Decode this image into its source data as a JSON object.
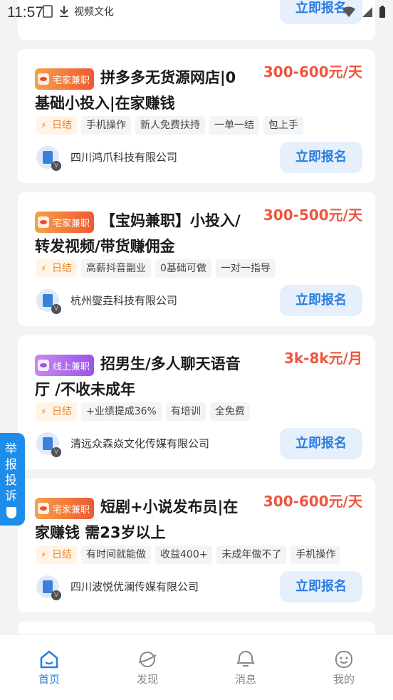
{
  "status_bar": {
    "time": "11:57",
    "notification_text": "视频文化"
  },
  "top_card": {
    "apply_label": "立即报名"
  },
  "jobs": [
    {
      "category": "宅家兼职",
      "title": "拼多多无货源网店|0基础小投入|在家赚钱",
      "salary": "300-600元/天",
      "tags": [
        "日结",
        "手机操作",
        "新人免费扶持",
        "一单一结",
        "包上手"
      ],
      "company": "四川鸿爪科技有限公司",
      "apply_label": "立即报名"
    },
    {
      "category": "宅家兼职",
      "title": "【宝妈兼职】小投入/转发视频/带货赚佣金",
      "salary": "300-500元/天",
      "tags": [
        "日结",
        "高薪抖音副业",
        "0基础可做",
        "一对一指导"
      ],
      "company": "杭州燮垚科技有限公司",
      "apply_label": "立即报名"
    },
    {
      "category": "线上兼职",
      "title": "招男生/多人聊天语音厅 /不收未成年",
      "salary": "3k-8k元/月",
      "tags": [
        "日结",
        "+业绩提成36%",
        "有培训",
        "全免费"
      ],
      "company": "清远众森焱文化传媒有限公司",
      "apply_label": "立即报名"
    },
    {
      "category": "宅家兼职",
      "title": "短剧+小说发布员|在家赚钱 需23岁以上",
      "salary": "300-600元/天",
      "tags": [
        "日结",
        "有时间就能做",
        "收益400+",
        "未成年做不了",
        "手机操作"
      ],
      "company": "四川波悦优澜传媒有限公司",
      "apply_label": "立即报名"
    }
  ],
  "report_button": "举报投诉",
  "tabbar": {
    "items": [
      {
        "label": "首页",
        "icon": "home-icon",
        "active": true
      },
      {
        "label": "发现",
        "icon": "planet-icon",
        "active": false
      },
      {
        "label": "消息",
        "icon": "message-icon",
        "active": false
      },
      {
        "label": "我的",
        "icon": "smiley-icon",
        "active": false
      }
    ]
  },
  "colors": {
    "accent": "#2c7de0",
    "salary": "#f0553f",
    "background": "#f2f3f5"
  }
}
